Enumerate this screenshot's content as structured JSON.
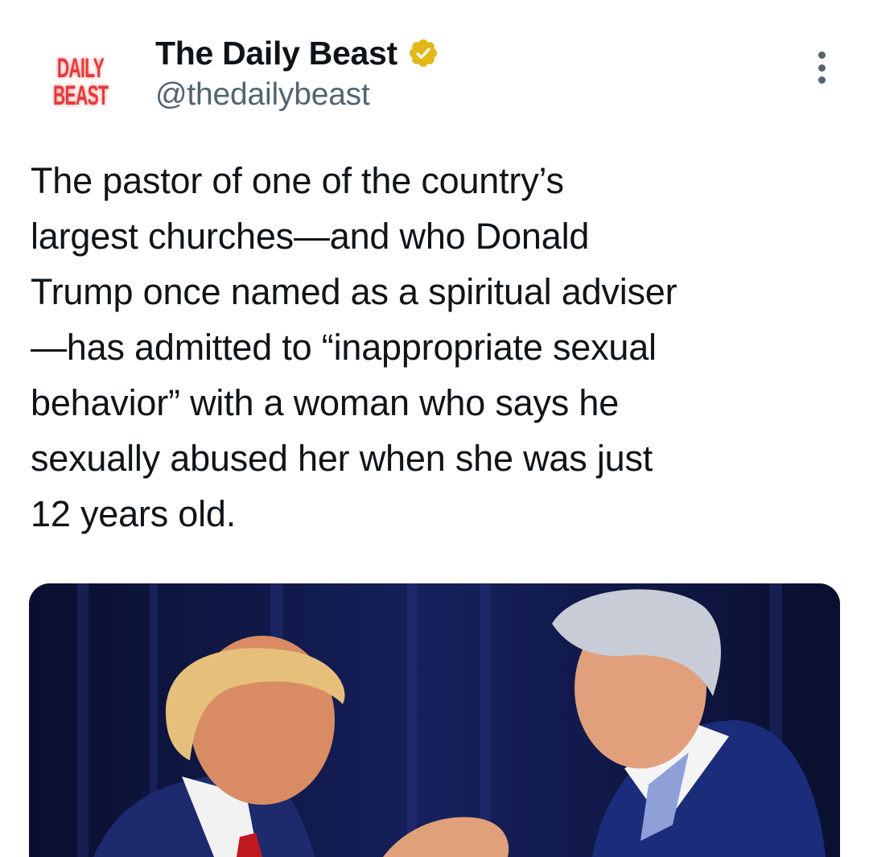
{
  "author": {
    "avatar_logo": [
      "DAILY",
      "BEAST"
    ],
    "display_name": "The Daily Beast",
    "handle": "@thedailybeast",
    "verified_icon": "verified-badge-gold-icon"
  },
  "tweet": {
    "text": "The pastor of one of the country’s\nlargest churches—and who Donald\nTrump once named as a spiritual adviser\n—has admitted to “inappropriate sexual\nbehavior” with a woman who says he\nsexually abused her when she was just\n12 years old."
  },
  "more_icon": "more-options-icon",
  "colors": {
    "text": "#0f1419",
    "secondary": "#536471",
    "badge": "#e2b719",
    "logo": "#e33b3b"
  }
}
